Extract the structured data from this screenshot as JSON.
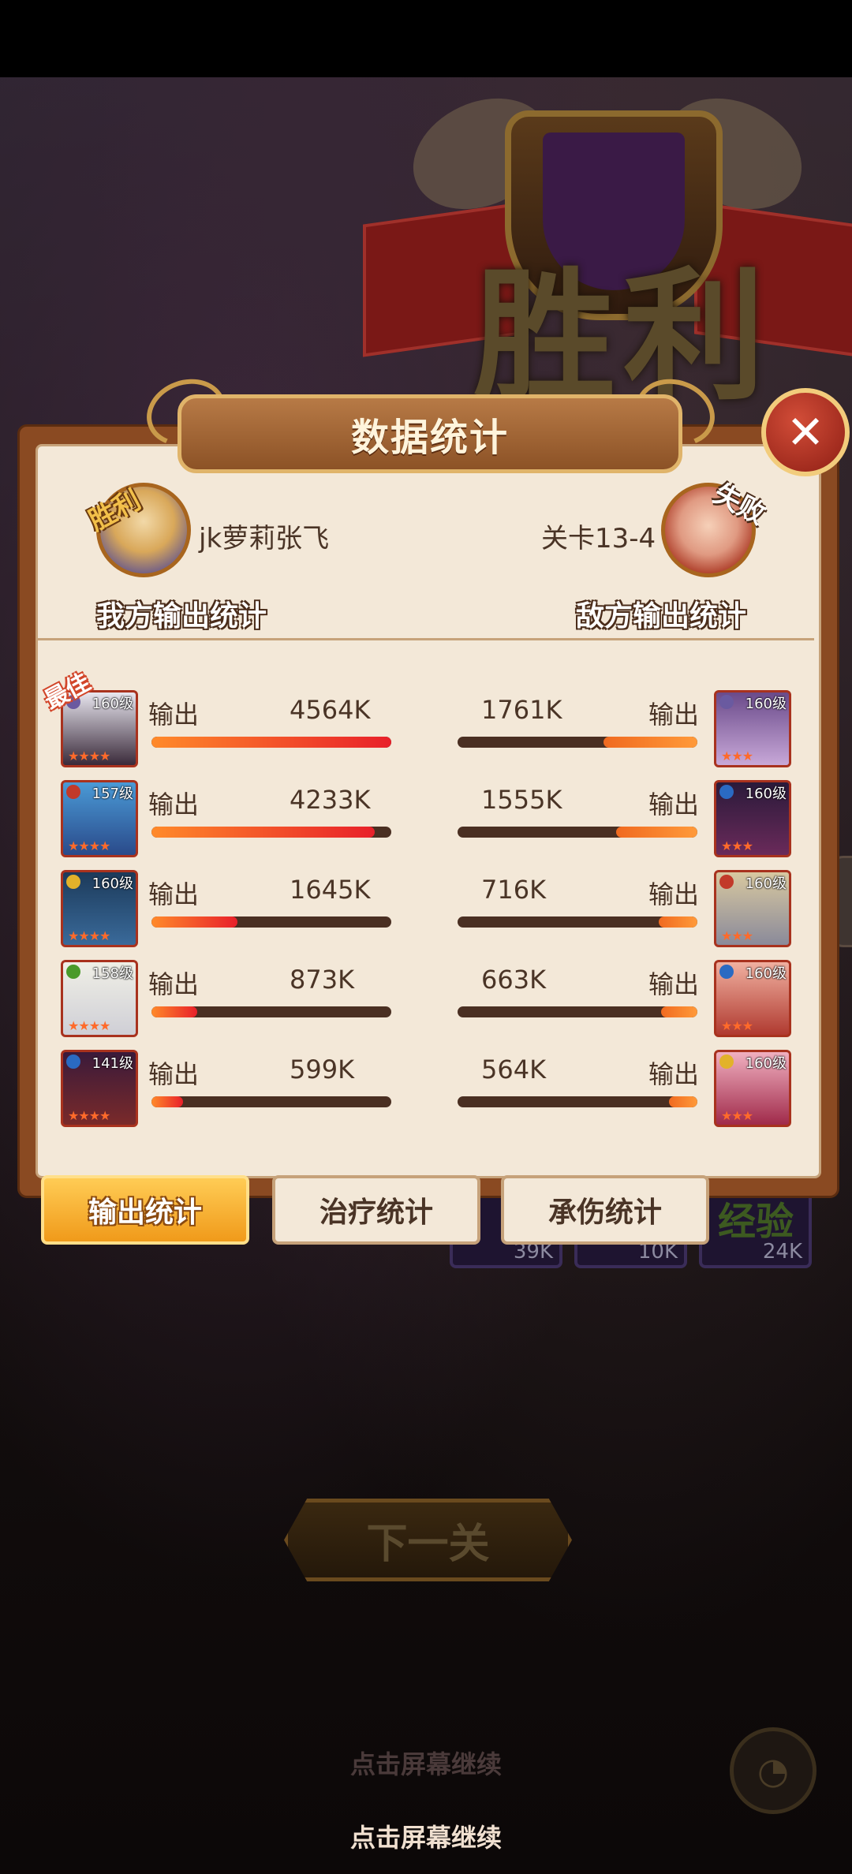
{
  "background": {
    "victory_text": "胜利",
    "rewards": [
      {
        "label": "",
        "value": "39K"
      },
      {
        "label": "",
        "value": "10K"
      },
      {
        "label": "经验",
        "value": "24K"
      }
    ]
  },
  "panel": {
    "title": "数据统计",
    "close_icon": "✕",
    "my_side": {
      "stamp": "胜利",
      "name": "jk萝莉张飞",
      "label": "我方输出统计"
    },
    "enemy_side": {
      "stamp": "失败",
      "name": "关卡13-4",
      "label": "敌方输出统计"
    },
    "best_tag": "最佳",
    "output_label": "输出",
    "rows": [
      {
        "left": {
          "level": "160级",
          "value": "4564K",
          "ratio": 1.0,
          "element": "#6a5aa0"
        },
        "right": {
          "level": "160级",
          "value": "1761K",
          "ratio": 0.39,
          "element": "#6a5aa0"
        }
      },
      {
        "left": {
          "level": "157级",
          "value": "4233K",
          "ratio": 0.93,
          "element": "#c23a2a"
        },
        "right": {
          "level": "160级",
          "value": "1555K",
          "ratio": 0.34,
          "element": "#2a6ac2"
        }
      },
      {
        "left": {
          "level": "160级",
          "value": "1645K",
          "ratio": 0.36,
          "element": "#e2b22a"
        },
        "right": {
          "level": "160级",
          "value": "716K",
          "ratio": 0.16,
          "element": "#c23a2a"
        }
      },
      {
        "left": {
          "level": "158级",
          "value": "873K",
          "ratio": 0.19,
          "element": "#4a9a2a"
        },
        "right": {
          "level": "160级",
          "value": "663K",
          "ratio": 0.15,
          "element": "#2a6ac2"
        }
      },
      {
        "left": {
          "level": "141级",
          "value": "599K",
          "ratio": 0.13,
          "element": "#2a6ac2"
        },
        "right": {
          "level": "160级",
          "value": "564K",
          "ratio": 0.12,
          "element": "#e2b22a"
        }
      }
    ]
  },
  "tabs": [
    {
      "label": "输出统计",
      "active": true
    },
    {
      "label": "治疗统计",
      "active": false
    },
    {
      "label": "承伤统计",
      "active": false
    }
  ],
  "next_button": "下一关",
  "tap_hint_1": "点击屏幕继续",
  "tap_hint_2": "点击屏幕继续",
  "colors": {
    "accent": "#f09a1a",
    "bar_ours": "#e8202a",
    "bar_enemy": "#ff9a3a",
    "panel_bg": "#f3e8d8"
  }
}
